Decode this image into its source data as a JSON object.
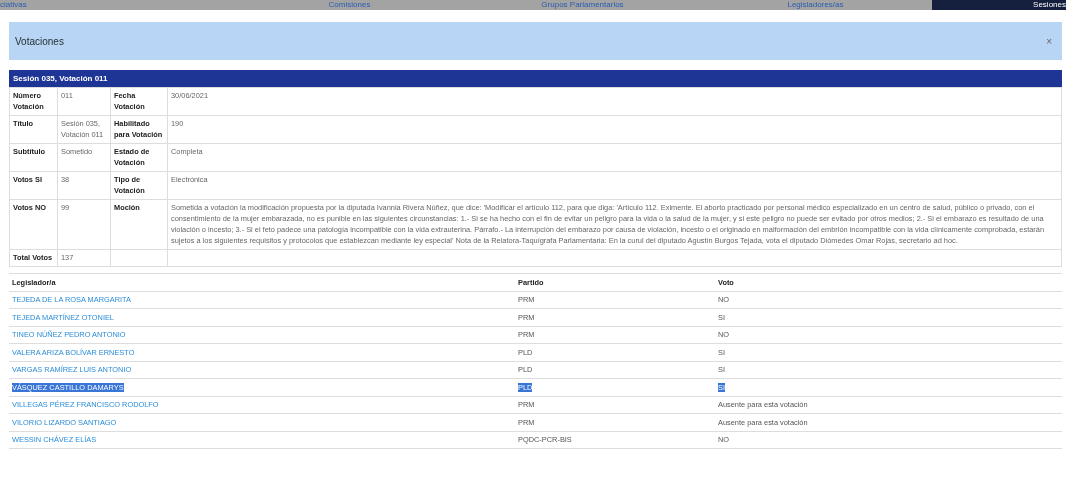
{
  "nav_tabs": [
    {
      "label": "ciativas",
      "selected": false
    },
    {
      "label": "Comisiones",
      "selected": false
    },
    {
      "label": "Grupos Parlamentarios",
      "selected": false
    },
    {
      "label": "Legisladores/as",
      "selected": false
    },
    {
      "label": "Sesiones",
      "selected": true
    }
  ],
  "dialog": {
    "title": "Votaciones",
    "close": "×"
  },
  "details": {
    "title": "Sesión 035, Votación 011",
    "rows": [
      {
        "label": "Número Votación",
        "value": "011",
        "label_2": "Fecha Votación",
        "value_2": "30/06/2021"
      },
      {
        "label": "Título",
        "value": "Sesión 035, Votación 011",
        "label_2": "Habilitado para Votación",
        "value_2": "190"
      },
      {
        "label": "Subtítulo",
        "value": "Sometido",
        "label_2": "Estado de Votación",
        "value_2": "Completa"
      },
      {
        "label": "Votos SI",
        "value": "38",
        "label_2": "Tipo de Votación",
        "value_2": "Electrónica"
      },
      {
        "label": "Votos NO",
        "value": "99",
        "label_2": "Moción",
        "value_2": "Sometida a votación la modificación propuesta por la diputada Ivannia Rivera Núñez, que dice: 'Modificar el artículo 112, para que diga: 'Artículo 112. Eximente. El aborto practicado por personal médico especializado en un centro de salud, público o privado, con el consentimiento de la mujer embarazada, no es punible en las siguientes circunstancias: 1.- Si se ha hecho con el fin de evitar un peligro para la vida o la salud de la mujer, y si este peligro no puede ser evitado por otros medios; 2.- Si el embarazo es resultado de una violación o incesto; 3.- Si el feto padece una patología incompatible con la vida extrauterina. Párrafo.- La interrupción del embarazo por causa de violación, incesto o el originado en malformación del embrión incompatible con la vida clínicamente comprobada, estarán sujetos a los siguientes requisitos y protocolos que establezcan mediante ley especial' Nota de la Relatora-Taquígrafa Parlamentaria: En la curul del diputado Agustín Burgos Tejada, vota el diputado Diómedes Omar Rojas, secretario ad hoc."
      },
      {
        "label": "Total Votos",
        "value": "137"
      }
    ]
  },
  "votes": {
    "columns": [
      "Legislador/a",
      "Partido",
      "Voto"
    ],
    "rows": [
      {
        "name": "TEJEDA DE LA ROSA MARGARITA",
        "party": "PRM",
        "vote": "NO",
        "selected": false
      },
      {
        "name": "TEJEDA MARTÍNEZ OTONIEL",
        "party": "PRM",
        "vote": "SI",
        "selected": false
      },
      {
        "name": "TINEO NÚÑEZ PEDRO ANTONIO",
        "party": "PRM",
        "vote": "NO",
        "selected": false
      },
      {
        "name": "VALERA ARIZA BOLÍVAR ERNESTO",
        "party": "PLD",
        "vote": "SI",
        "selected": false
      },
      {
        "name": "VARGAS RAMÍREZ LUIS ANTONIO",
        "party": "PLD",
        "vote": "SI",
        "selected": false
      },
      {
        "name": "VÁSQUEZ CASTILLO DAMARYS",
        "party": "PLD",
        "vote": "SI",
        "selected": true
      },
      {
        "name": "VILLEGAS PÉREZ FRANCISCO RODOLFO",
        "party": "PRM",
        "vote": "Ausente para esta votación",
        "selected": false
      },
      {
        "name": "VILORIO LIZARDO SANTIAGO",
        "party": "PRM",
        "vote": "Ausente para esta votación",
        "selected": false
      },
      {
        "name": "WESSIN CHÁVEZ ELÍAS",
        "party": "PQDC-PCR-BIS",
        "vote": "NO",
        "selected": false
      }
    ]
  }
}
